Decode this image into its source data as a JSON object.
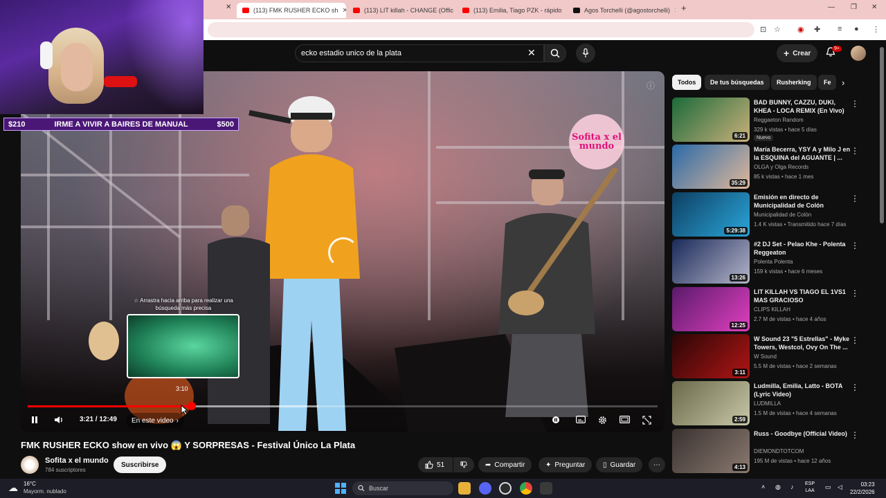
{
  "browser": {
    "tabs": [
      {
        "title": "(113) FMK RUSHER ECKO sh",
        "favicon": "youtube",
        "active": true
      },
      {
        "title": "(113) LIT killah - CHANGE (Offic",
        "favicon": "youtube",
        "active": false
      },
      {
        "title": "(113) Emilia, Tiago PZK - rápido",
        "favicon": "youtube",
        "active": false
      },
      {
        "title": "Agos Torchelli (@agostorchelli)",
        "favicon": "tiktok",
        "active": false
      }
    ],
    "new_tab_label": "+"
  },
  "masthead": {
    "search_query": "ecko estadio unico de la plata",
    "create_label": "Crear",
    "notifications_badge": "9+"
  },
  "stream_overlay": {
    "goal_left": "$210",
    "goal_text": "IRME A VIVIR A BAIRES DE MANUAL",
    "goal_right": "$500"
  },
  "player": {
    "watermark_text": "Sofita x el mundo",
    "drag_hint": "☆ Arrastra hacia arriba para realizar una búsqueda más precisa",
    "preview_time": "3:10",
    "time_display": "3:21 / 12:49",
    "progress_fraction": 0.26,
    "chapter_label": "En este video"
  },
  "video": {
    "title": "FMK RUSHER ECKO show en vivo 😱 Y SORPRESAS - Festival Único La Plata",
    "channel_name": "Sofita x el mundo",
    "subscribers": "784 suscriptores",
    "subscribe_label": "Suscribirse",
    "likes": "51",
    "share_label": "Compartir",
    "ask_label": "Preguntar",
    "save_label": "Guardar"
  },
  "chips": [
    {
      "label": "Todos",
      "active": true
    },
    {
      "label": "De tus búsquedas",
      "active": false
    },
    {
      "label": "Rusherking",
      "active": false
    },
    {
      "label": "Fe",
      "active": false
    }
  ],
  "related": [
    {
      "title": "BAD BUNNY, CAZZU, DUKI, KHEA - LOCA REMIX (En Vivo) ...",
      "channel": "Reggaeton Random",
      "meta": "329 k vistas • hace 5 días",
      "duration": "6:21",
      "badge": "Nuevo",
      "thumb_colors": [
        "#1b6a3a",
        "#c9b07a"
      ]
    },
    {
      "title": "María Becerra, YSY A y Milo J en la ESQUINA del AGUANTE | ...",
      "channel": "OLGA y Olga Records",
      "meta": "85 k vistas • hace 1 mes",
      "duration": "35:29",
      "badge": "",
      "thumb_colors": [
        "#2a6aa8",
        "#e0b89a"
      ]
    },
    {
      "title": "Emisión en directo de Municipalidad de Colón",
      "channel": "Municipalidad de Colón",
      "meta": "1.4 K vistas • Transmitido hace 7 días",
      "duration": "5:29:38",
      "badge": "",
      "thumb_colors": [
        "#0e3f63",
        "#2aa6d9"
      ]
    },
    {
      "title": "#2 DJ Set - Pelao Khe - Polenta Reggeaton",
      "channel": "Polenta Polenta",
      "meta": "159 k vistas • hace 6 meses",
      "duration": "13:26",
      "badge": "",
      "thumb_colors": [
        "#1a2a5a",
        "#b5b5c8"
      ]
    },
    {
      "title": "LIT KILLAH VS TIAGO EL 1VS1 MAS GRACIOSO",
      "channel": "CLIPS KILLAH",
      "meta": "2.7 M de vistas • hace 4 años",
      "duration": "12:25",
      "badge": "",
      "thumb_colors": [
        "#5a1a6a",
        "#e040c0"
      ]
    },
    {
      "title": "W Sound 23 \"5 Estrellas\" - Myke Towers, Westcol, Ovy On The ...",
      "channel": "W Sound",
      "meta": "5.5 M de vistas • hace 2 semanas",
      "duration": "3:11",
      "badge": "",
      "thumb_colors": [
        "#2a0606",
        "#b01515"
      ]
    },
    {
      "title": "Ludmilla, Emilia, Latto - BOTA (Lyric Video)",
      "channel": "LUDMILLA",
      "meta": "1.5 M de vistas • hace 4 semanas",
      "duration": "2:59",
      "badge": "",
      "thumb_colors": [
        "#6a6a4a",
        "#c8c8a8"
      ]
    },
    {
      "title": "Russ - Goodbye (Official Video)",
      "channel": "DIEMONDTOTCOM",
      "meta": "195 M de vistas • hace 12 años",
      "duration": "4:13",
      "badge": "",
      "thumb_colors": [
        "#3a3230",
        "#8a7a70"
      ]
    }
  ],
  "taskbar": {
    "temperature": "16°C",
    "condition": "Mayorm. nublado",
    "search_placeholder": "Buscar",
    "lang_top": "ESP",
    "lang_bottom": "LAA",
    "time": "03:23",
    "date": "22/2/2026"
  },
  "colors": {
    "youtube_red": "#ff0000",
    "background": "#0f0f0f",
    "overlay_purple": "#4a1776"
  }
}
